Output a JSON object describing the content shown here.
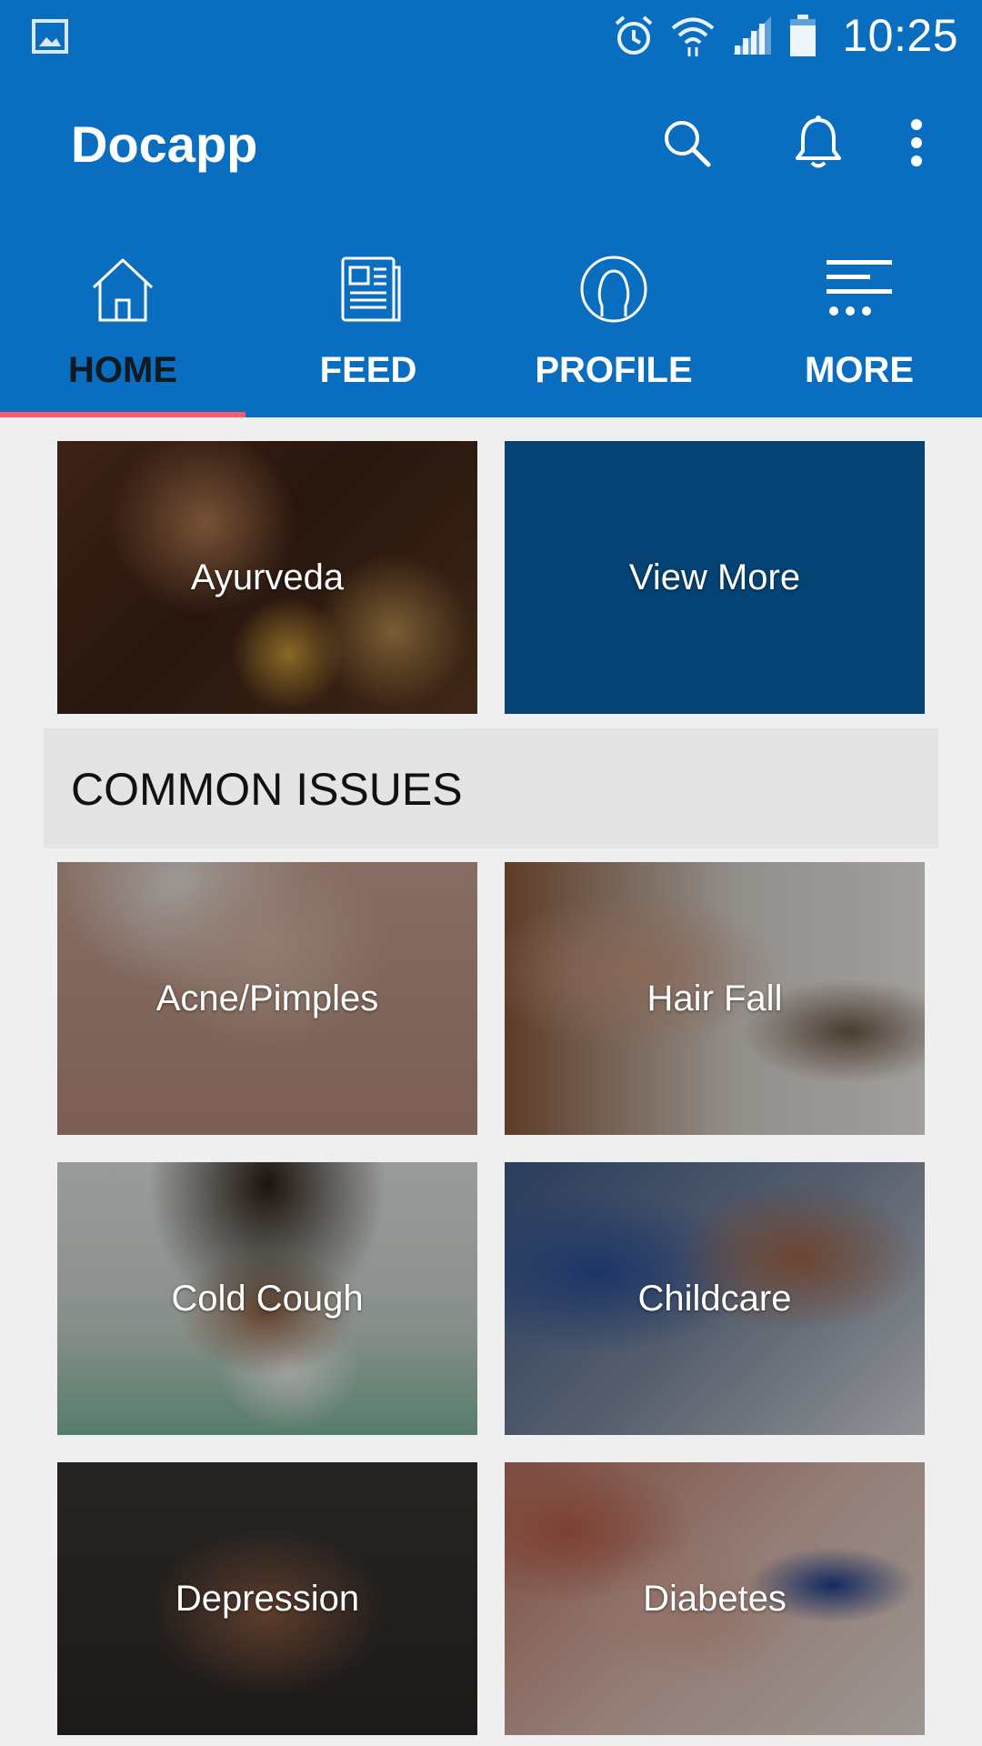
{
  "status_bar": {
    "time": "10:25",
    "icons": [
      "gallery-icon",
      "alarm-icon",
      "wifi-icon",
      "signal-icon",
      "battery-icon"
    ]
  },
  "app_bar": {
    "title": "Docapp",
    "actions": [
      "search-icon",
      "bell-icon",
      "overflow-menu-icon"
    ]
  },
  "tabs": [
    {
      "label": "HOME",
      "icon": "home-icon",
      "active": true
    },
    {
      "label": "FEED",
      "icon": "newspaper-icon",
      "active": false
    },
    {
      "label": "PROFILE",
      "icon": "person-icon",
      "active": false
    },
    {
      "label": "MORE",
      "icon": "more-icon",
      "active": false
    }
  ],
  "top_tiles": [
    {
      "label": "Ayurveda"
    },
    {
      "label": "View More"
    }
  ],
  "section": {
    "title": "COMMON ISSUES"
  },
  "issues": [
    {
      "label": "Acne/Pimples"
    },
    {
      "label": "Hair Fall"
    },
    {
      "label": "Cold Cough"
    },
    {
      "label": "Childcare"
    },
    {
      "label": "Depression"
    },
    {
      "label": "Diabetes"
    }
  ],
  "colors": {
    "primary": "#0a6ec0",
    "tab_indicator": "#ff5a6e",
    "view_more_tile": "#044374",
    "background": "#efefef",
    "section_header_bg": "#e4e4e4"
  }
}
